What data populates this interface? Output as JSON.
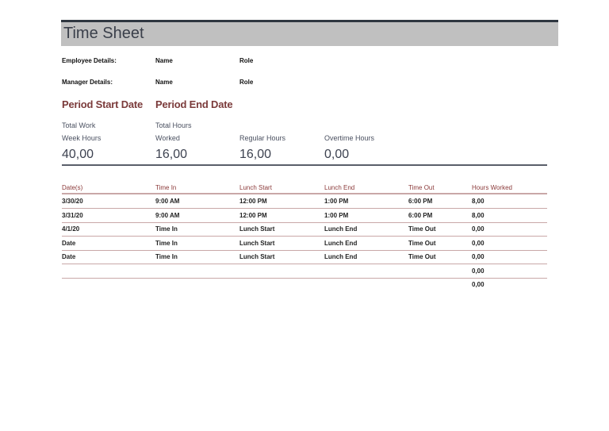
{
  "title": "Time Sheet",
  "employee": {
    "label": "Employee Details:",
    "name": "Name",
    "role": "Role"
  },
  "manager": {
    "label": "Manager Details:",
    "name": "Name",
    "role": "Role"
  },
  "period": {
    "start": "Period Start Date",
    "end": "Period End Date"
  },
  "summary": [
    {
      "line1": "Total Work",
      "line2": "Week Hours",
      "value": "40,00"
    },
    {
      "line1": "Total Hours",
      "line2": "Worked",
      "value": "16,00"
    },
    {
      "line1": "",
      "line2": "Regular Hours",
      "value": "16,00"
    },
    {
      "line1": "",
      "line2": "Overtime Hours",
      "value": "0,00"
    }
  ],
  "table": {
    "headers": [
      "Date(s)",
      "Time In",
      "Lunch Start",
      "Lunch End",
      "Time Out",
      "Hours Worked"
    ],
    "rows": [
      [
        "3/30/20",
        "9:00 AM",
        "12:00 PM",
        "1:00 PM",
        "6:00 PM",
        "8,00"
      ],
      [
        "3/31/20",
        "9:00 AM",
        "12:00 PM",
        "1:00 PM",
        "6:00 PM",
        "8,00"
      ],
      [
        "4/1/20",
        "Time In",
        "Lunch Start",
        "Lunch End",
        "Time Out",
        "0,00"
      ],
      [
        "Date",
        "Time In",
        "Lunch Start",
        "Lunch End",
        "Time Out",
        "0,00"
      ],
      [
        "Date",
        "Time In",
        "Lunch Start",
        "Lunch End",
        "Time Out",
        "0,00"
      ],
      [
        "",
        "",
        "",
        "",
        "",
        "0,00"
      ],
      [
        "",
        "",
        "",
        "",
        "",
        "0,00"
      ]
    ]
  }
}
